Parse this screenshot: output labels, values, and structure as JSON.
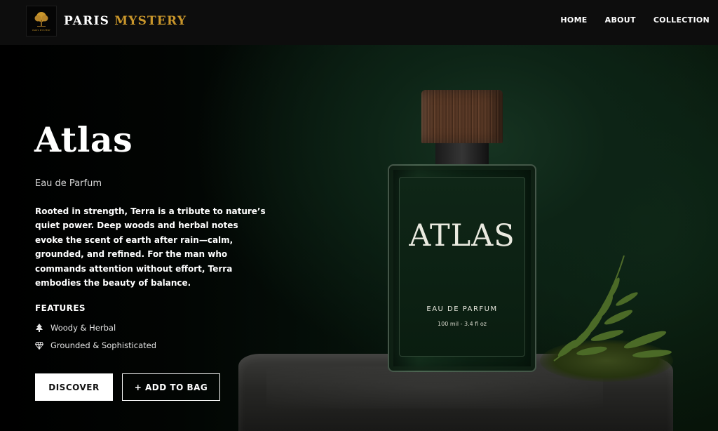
{
  "brand": {
    "logo_text": "PARIS MYSTERY",
    "name_part1": "PARIS",
    "name_part2": "MYSTERY",
    "accent_color": "#c9962b",
    "logo_icon": "tree-icon"
  },
  "nav": {
    "items": [
      {
        "label": "HOME"
      },
      {
        "label": "ABOUT"
      },
      {
        "label": "COLLECTION"
      }
    ]
  },
  "hero": {
    "title": "Atlas",
    "subtitle": "Eau de Parfum",
    "description": "Rooted in strength, Terra is a tribute to nature’s quiet power. Deep woods and herbal notes evoke the scent of earth after rain—calm, grounded, and refined. For the man who commands attention without effort, Terra embodies the beauty of balance.",
    "features_label": "FEATURES",
    "features": [
      {
        "icon": "tree-icon",
        "label": "Woody & Herbal"
      },
      {
        "icon": "diamond-icon",
        "label": "Grounded & Sophisticated"
      }
    ],
    "buttons": {
      "discover": "DISCOVER",
      "add_to_bag": "+ ADD TO BAG"
    }
  },
  "bottle": {
    "name": "ATLAS",
    "type": "EAU DE PARFUM",
    "size": "100 mil - 3.4 fl oz"
  }
}
